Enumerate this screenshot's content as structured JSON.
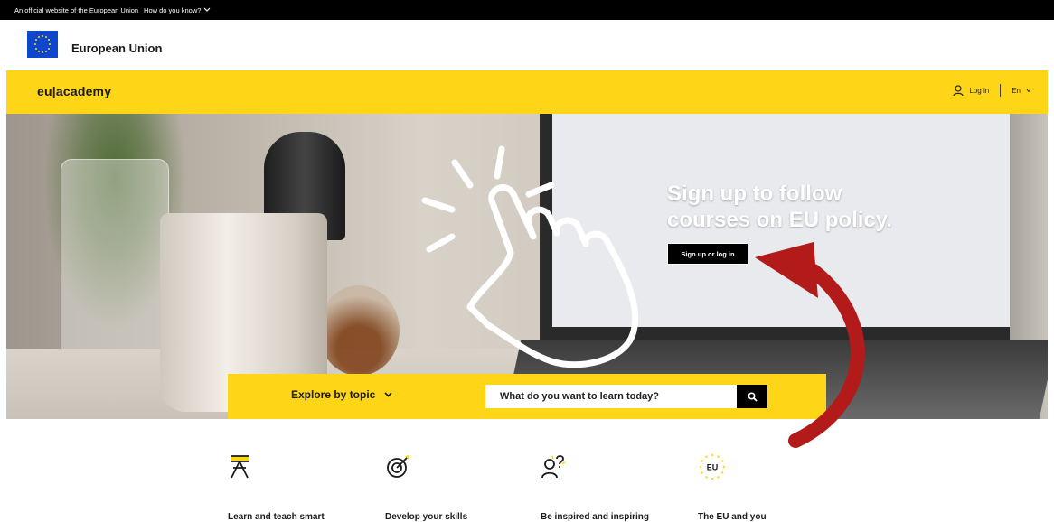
{
  "top_bar": {
    "official_text": "An official website of the European Union",
    "how_text": "How do you know?"
  },
  "eu_header": {
    "name": "European Union"
  },
  "nav": {
    "brand": "eu|academy",
    "login": "Log in",
    "language": "En"
  },
  "hero": {
    "title_line1": "Sign up to follow",
    "title_line2": "courses on EU policy.",
    "button": "Sign up or log in"
  },
  "search": {
    "explore_label": "Explore by topic",
    "placeholder": "What do you want to learn today?"
  },
  "features": [
    {
      "label": "Learn and teach smart",
      "icon": "graduate-icon"
    },
    {
      "label": "Develop your skills",
      "icon": "target-icon"
    },
    {
      "label": "Be inspired and inspiring",
      "icon": "people-question-icon"
    },
    {
      "label": "The EU and you",
      "icon": "eu-stars-icon",
      "badge": "EU"
    }
  ],
  "colors": {
    "brand_yellow": "#ffd617",
    "eu_blue": "#0e47cb",
    "arrow_red": "#b31b1b"
  }
}
